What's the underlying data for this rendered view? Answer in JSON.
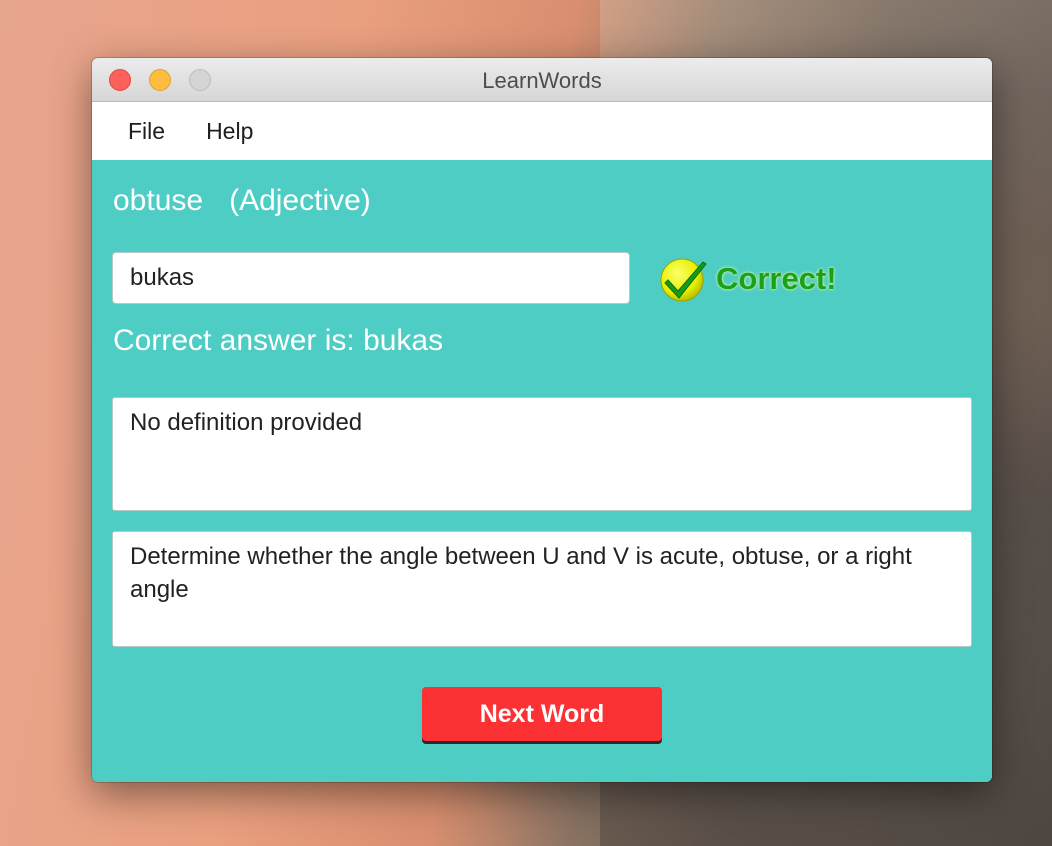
{
  "window": {
    "title": "LearnWords"
  },
  "menu": {
    "items": [
      {
        "label": "File"
      },
      {
        "label": "Help"
      }
    ]
  },
  "quiz": {
    "word": "obtuse",
    "part_of_speech": "(Adjective)",
    "answer_value": "bukas",
    "result_label": "Correct!",
    "result_icon": "check-icon",
    "correct_answer_text": "Correct answer is: bukas",
    "definition": "No definition provided",
    "example": "Determine whether the angle between U and V is acute, obtuse, or a right angle",
    "next_button_label": "Next Word"
  },
  "colors": {
    "content_background": "#4ecdc4",
    "result_text": "#1aa11a",
    "next_button": "#fb3133"
  }
}
